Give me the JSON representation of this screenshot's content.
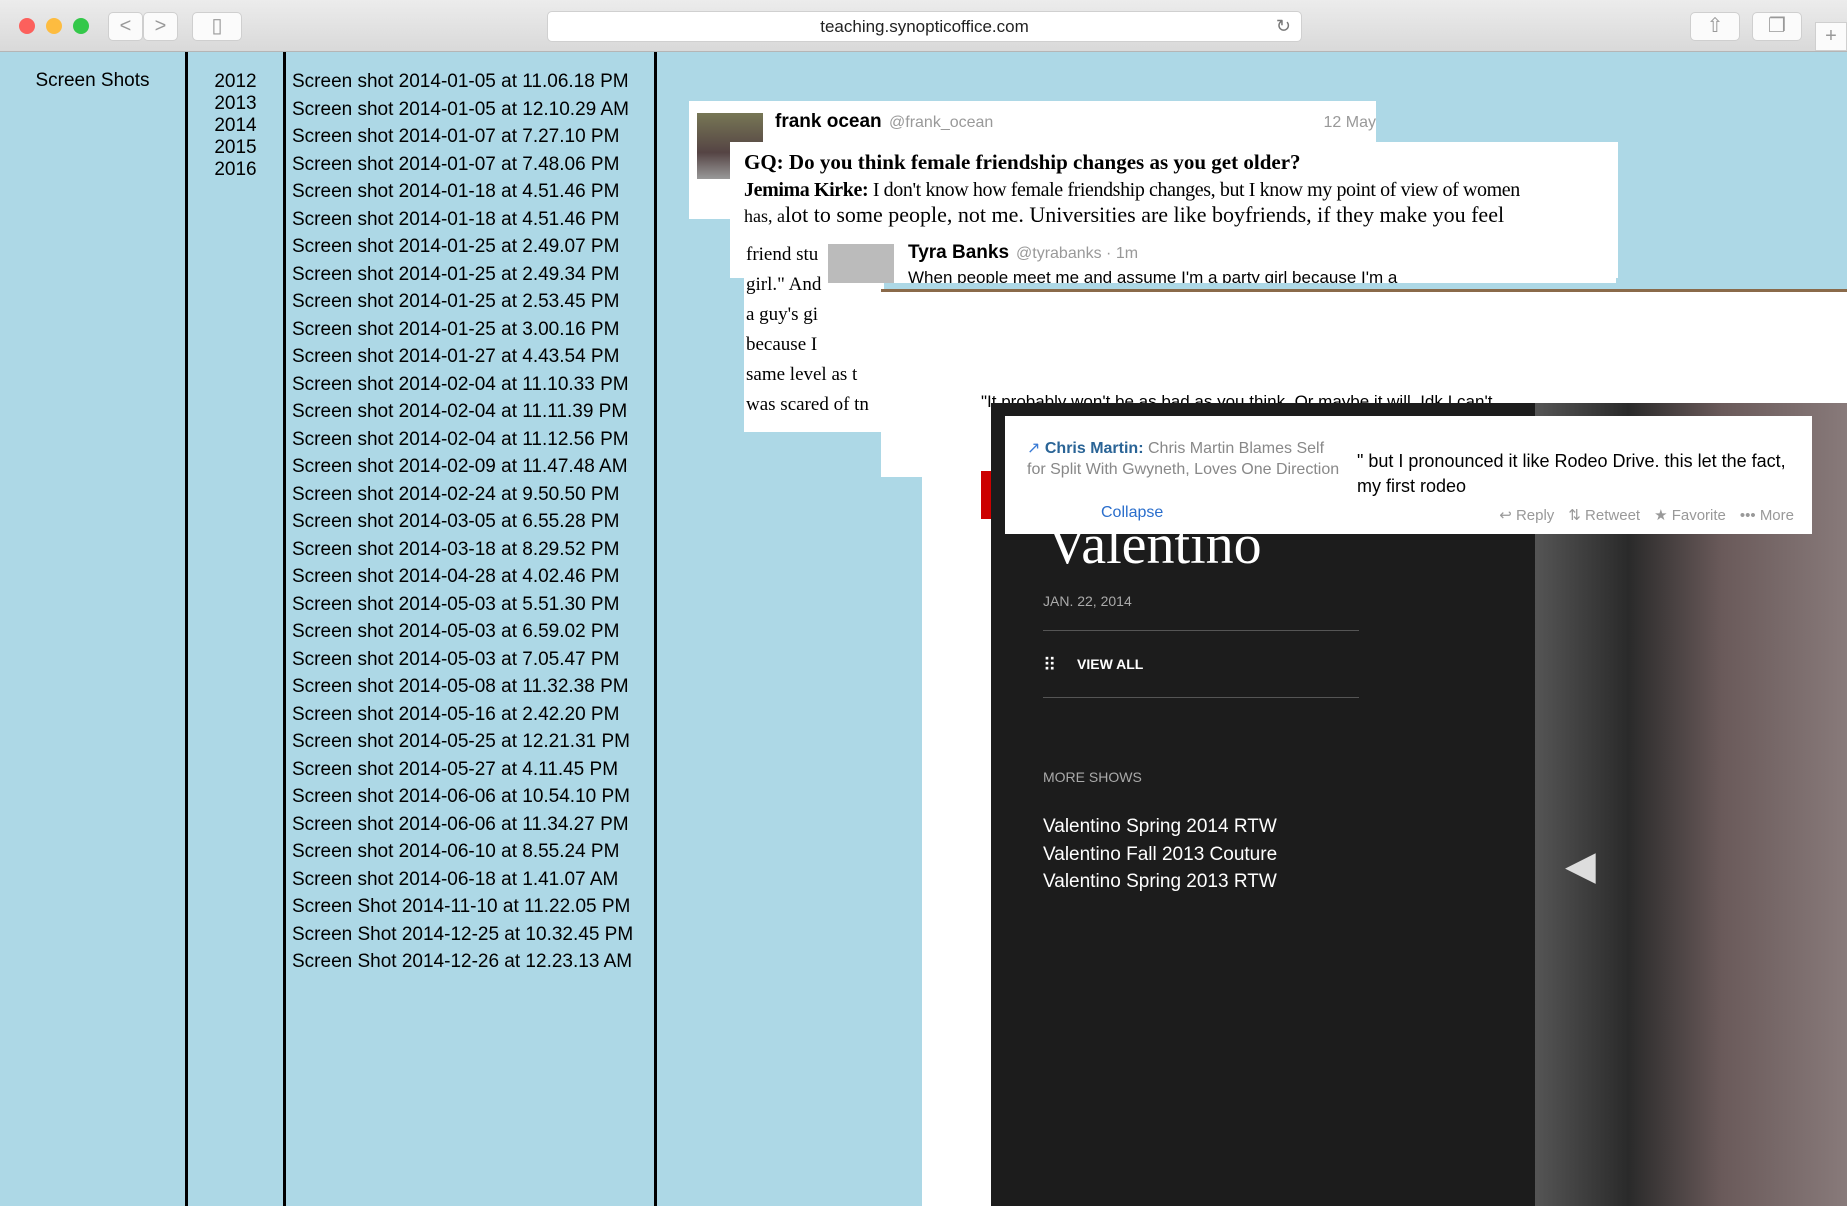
{
  "browser": {
    "url": "teaching.synopticoffice.com",
    "back": "<",
    "forward": ">"
  },
  "columns": {
    "title": "Screen Shots",
    "years": [
      "2012",
      "2013",
      "2014",
      "2015",
      "2016"
    ],
    "files": [
      "Screen shot 2014-01-05 at 11.06.18 PM",
      "Screen shot 2014-01-05 at 12.10.29 AM",
      "Screen shot 2014-01-07 at 7.27.10 PM",
      "Screen shot 2014-01-07 at 7.48.06 PM",
      "Screen shot 2014-01-18 at 4.51.46 PM",
      "Screen shot 2014-01-18 at 4.51.46 PM",
      "Screen shot 2014-01-25 at 2.49.07 PM",
      "Screen shot 2014-01-25 at 2.49.34 PM",
      "Screen shot 2014-01-25 at 2.53.45 PM",
      "Screen shot 2014-01-25 at 3.00.16 PM",
      "Screen shot 2014-01-27 at 4.43.54 PM",
      "Screen shot 2014-02-04 at 11.10.33 PM",
      "Screen shot 2014-02-04 at 11.11.39 PM",
      "Screen shot 2014-02-04 at 11.12.56 PM",
      "Screen shot 2014-02-09 at 11.47.48 AM",
      "Screen shot 2014-02-24 at 9.50.50 PM",
      "Screen shot 2014-03-05 at 6.55.28 PM",
      "Screen shot 2014-03-18 at 8.29.52 PM",
      "Screen shot 2014-04-28 at 4.02.46 PM",
      "Screen shot 2014-05-03 at 5.51.30 PM",
      "Screen shot 2014-05-03 at 6.59.02 PM",
      "Screen shot 2014-05-03 at 7.05.47 PM",
      "Screen shot 2014-05-08 at 11.32.38 PM",
      "Screen shot 2014-05-16 at 2.42.20 PM",
      "Screen shot 2014-05-25 at 12.21.31 PM",
      "Screen shot 2014-05-27 at 4.11.45 PM",
      "Screen shot 2014-06-06 at 10.54.10 PM",
      "Screen shot 2014-06-06 at 11.34.27 PM",
      "Screen shot 2014-06-10 at 8.55.24 PM",
      "Screen shot 2014-06-18 at 1.41.07 AM",
      "Screen Shot 2014-11-10 at 11.22.05 PM",
      "Screen Shot 2014-12-25 at 10.32.45 PM",
      "Screen Shot 2014-12-26 at 12.23.13 AM"
    ]
  },
  "collage": {
    "frank": {
      "name": "frank ocean",
      "handle": "@frank_ocean",
      "date": "12 May"
    },
    "gq": {
      "q": "GQ: Do you think female friendship changes as you get older?",
      "a_name": "Jemima Kirke:",
      "a_text": " I don't know how female friendship changes, but I know my point of view of women",
      "line2a": "has, a",
      "line2b": "lot to some people, not me. Universities are like boyfriends, if they make you feel",
      "left_lines": [
        "friend stu",
        "girl.\" And",
        "a guy's gi",
        "because I",
        "same level as t",
        "was scared of tn"
      ]
    },
    "tyra": {
      "name": "Tyra Banks",
      "handle": "@tyrabanks · 1m",
      "text": "When people meet me and assume I'm a party girl because I'm a"
    },
    "quote": "\"It probably won't be as bad as you think. Or maybe it will. Idk I can't",
    "chris": {
      "name": "Chris Martin:",
      "headline": "Chris Martin Blames Self for Split With Gwyneth, Loves One Direction",
      "collapse": "Collapse",
      "tweet": "\" but I pronounced it like Rodeo Drive. this let the fact, my first rodeo",
      "actions": [
        "Reply",
        "Retweet",
        "Favorite",
        "More"
      ]
    },
    "valentino": {
      "title": "Valentino",
      "date": "JAN. 22, 2014",
      "view_all": "VIEW ALL",
      "more": "MORE SHOWS",
      "shows": [
        "Valentino Spring 2014 RTW",
        "Valentino Fall 2013 Couture",
        "Valentino Spring 2013 RTW"
      ]
    }
  }
}
